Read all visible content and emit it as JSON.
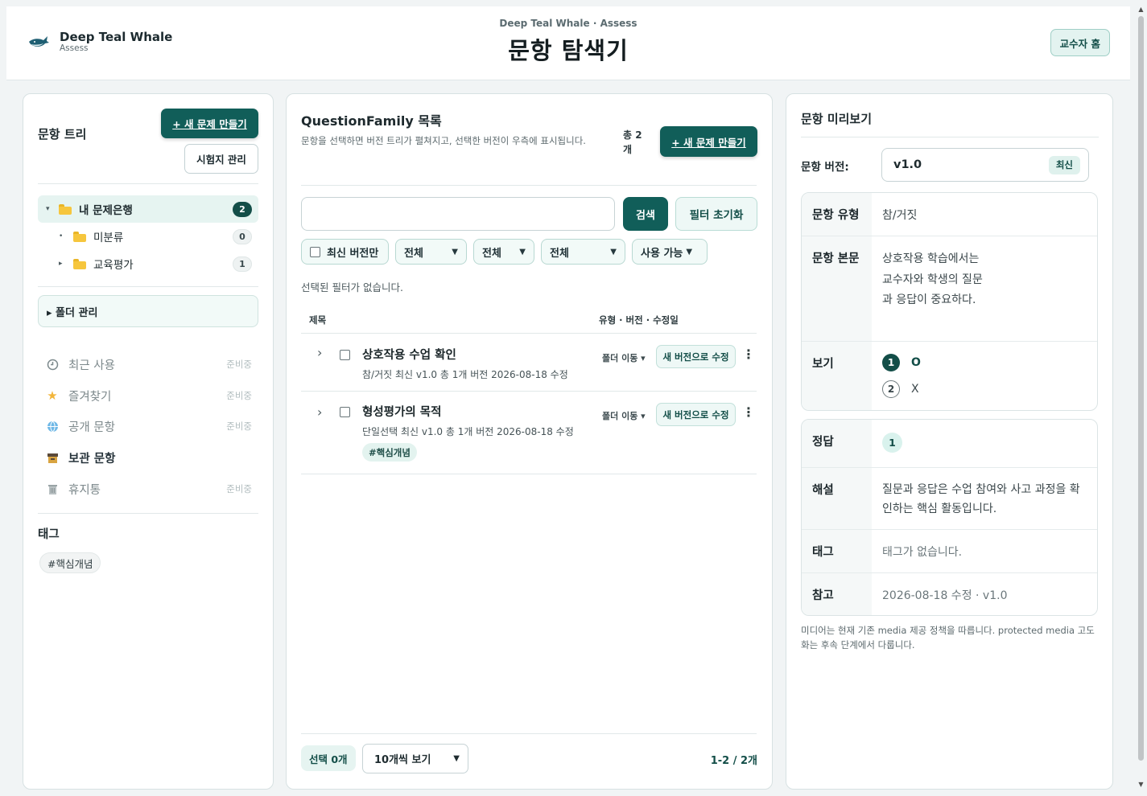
{
  "header": {
    "brand_name": "Deep Teal Whale",
    "brand_sub": "Assess",
    "kicker": "Deep Teal Whale · Assess",
    "title": "문항 탐색기",
    "professor_home": "교수자 홈"
  },
  "sidebar": {
    "title": "문항 트리",
    "new_problem": "+ 새 문제 만들기",
    "exam_manage": "시험지 관리",
    "tree": {
      "root": {
        "label": "내 문제은행",
        "count": "2"
      },
      "children": [
        {
          "label": "미분류",
          "count": "0"
        },
        {
          "label": "교육평가",
          "count": "1"
        }
      ]
    },
    "folder_manage": "▸ 폴더 관리",
    "nav": [
      {
        "label": "최근 사용",
        "status": "준비중",
        "icon": "clock-icon"
      },
      {
        "label": "즐겨찾기",
        "status": "준비중",
        "icon": "star-icon"
      },
      {
        "label": "공개 문항",
        "status": "준비중",
        "icon": "globe-icon"
      },
      {
        "label": "보관 문항",
        "status": "",
        "icon": "archive-icon"
      },
      {
        "label": "휴지통",
        "status": "준비중",
        "icon": "trash-icon"
      }
    ],
    "tags_title": "태그",
    "tags": [
      "#핵심개념"
    ]
  },
  "list": {
    "title": "QuestionFamily 목록",
    "description": "문항을 선택하면 버전 트리가 펼쳐지고, 선택한 버전이 우측에 표시됩니다.",
    "total": "총 2개",
    "new_problem": "+ 새 문제 만들기",
    "search_placeholder": "",
    "search_button": "검색",
    "reset_button": "필터 초기화",
    "filters": {
      "latest_only": "최신 버전만",
      "type": "전체",
      "folder": "전체",
      "tag": "전체",
      "status": "사용 가능"
    },
    "no_filter_text": "선택된 필터가 없습니다.",
    "columns": {
      "title": "제목",
      "meta": "유형 · 버전 · 수정일"
    },
    "rows": [
      {
        "title": "상호작용 수업 확인",
        "meta": "참/거짓   최신 v1.0   총 1개 버전   2026-08-18 수정",
        "tag": "",
        "move": "폴더 이동 ▾",
        "new_version": "새 버전으로 수정"
      },
      {
        "title": "형성평가의 목적",
        "meta": "단일선택   최신 v1.0   총 1개 버전   2026-08-18 수정",
        "tag": "#핵심개념",
        "move": "폴더 이동 ▾",
        "new_version": "새 버전으로 수정"
      }
    ],
    "selected_count": "선택 0개",
    "page_size": "10개씩 보기",
    "page_info": "1-2 / 2개"
  },
  "preview": {
    "title": "문항 미리보기",
    "version_label": "문항 버전:",
    "version_value": "v1.0",
    "latest_badge": "최신",
    "type_label": "문항 유형",
    "type_value": "참/거짓",
    "body_label": "문항 본문",
    "body_value": "상호작용 학습에서는 교수자와 학생의 질문과 응답이 중요하다.",
    "options_label": "보기",
    "options": [
      {
        "num": "1",
        "text": "O",
        "selected": true
      },
      {
        "num": "2",
        "text": "X",
        "selected": false
      }
    ],
    "answer_label": "정답",
    "answer_value": "1",
    "explanation_label": "해설",
    "explanation_value": "질문과 응답은 수업 참여와 사고 과정을 확인하는 핵심 활동입니다.",
    "tags_label": "태그",
    "tags_value": "태그가 없습니다.",
    "ref_label": "참고",
    "ref_value": "2026-08-18 수정 · v1.0",
    "media_note": "미디어는 현재 기존 media 제공 정책을 따릅니다. protected media 고도화는 후속 단계에서 다룹니다."
  }
}
